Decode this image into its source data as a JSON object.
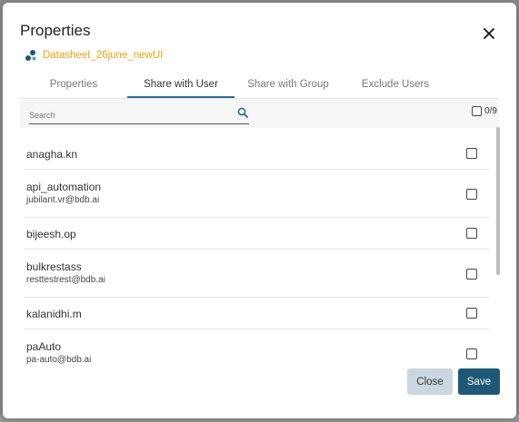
{
  "modal": {
    "title": "Properties",
    "dataset_name": "Datasheet_26june_newUI"
  },
  "tabs": [
    {
      "label": "Properties",
      "active": false
    },
    {
      "label": "Share with User",
      "active": true
    },
    {
      "label": "Share with Group",
      "active": false
    },
    {
      "label": "Exclude Users",
      "active": false
    }
  ],
  "search": {
    "placeholder": "Search",
    "value": ""
  },
  "selection": {
    "count": "0/9"
  },
  "users": [
    {
      "name": "anagha.kn",
      "email": "",
      "checked": false
    },
    {
      "name": "api_automation",
      "email": "jubilant.vr@bdb.ai",
      "checked": false
    },
    {
      "name": "bijeesh.op",
      "email": "",
      "checked": false
    },
    {
      "name": "bulkrestass",
      "email": "resttestrest@bdb.ai",
      "checked": false
    },
    {
      "name": "kalanidhi.m",
      "email": "",
      "checked": false
    },
    {
      "name": "paAuto",
      "email": "pa-auto@bdb.ai",
      "checked": false
    }
  ],
  "buttons": {
    "close_label": "Close",
    "save_label": "Save"
  },
  "colors": {
    "accent": "#1f5876",
    "dataset": "#e8a317",
    "tab_underline": "#2c6a8b"
  }
}
